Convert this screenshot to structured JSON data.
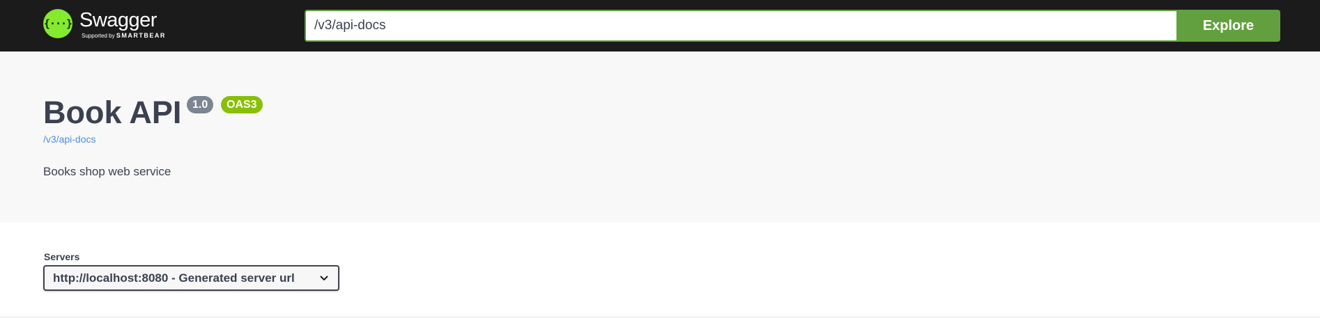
{
  "topbar": {
    "logo_mark": "{···}",
    "logo_title": "Swagger",
    "logo_sub_prefix": "Supported by",
    "logo_sub_brand": "SMARTBEAR",
    "url_value": "/v3/api-docs",
    "explore_label": "Explore"
  },
  "info": {
    "title": "Book API",
    "version": "1.0",
    "oas": "OAS3",
    "spec_link": "/v3/api-docs",
    "description": "Books shop web service"
  },
  "servers": {
    "label": "Servers",
    "selected": "http://localhost:8080 - Generated server url"
  },
  "colors": {
    "topbar_bg": "#1b1b1b",
    "accent_green": "#62a03f",
    "logo_green": "#85ea2d",
    "oas_badge": "#89bf04",
    "version_badge": "#7d8492",
    "link": "#4990e2",
    "text": "#3b4151"
  },
  "icons": {
    "logo": "swagger-logo-icon",
    "select": "chevron-down-icon"
  }
}
